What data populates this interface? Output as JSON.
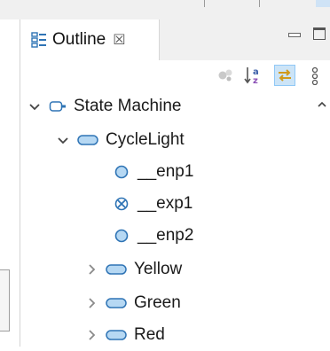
{
  "outline_view": {
    "tab_title": "Outline",
    "tab_close_glyph": "☒"
  },
  "tree": {
    "root": "State Machine",
    "region": "CycleLight",
    "children": [
      "__enp1",
      "__exp1",
      "__enp2",
      "Yellow",
      "Green",
      "Red"
    ]
  },
  "colors": {
    "state_fill": "#b6d8f3",
    "state_stroke": "#2f74b5",
    "active_toggle_bg": "#cce4f7"
  }
}
